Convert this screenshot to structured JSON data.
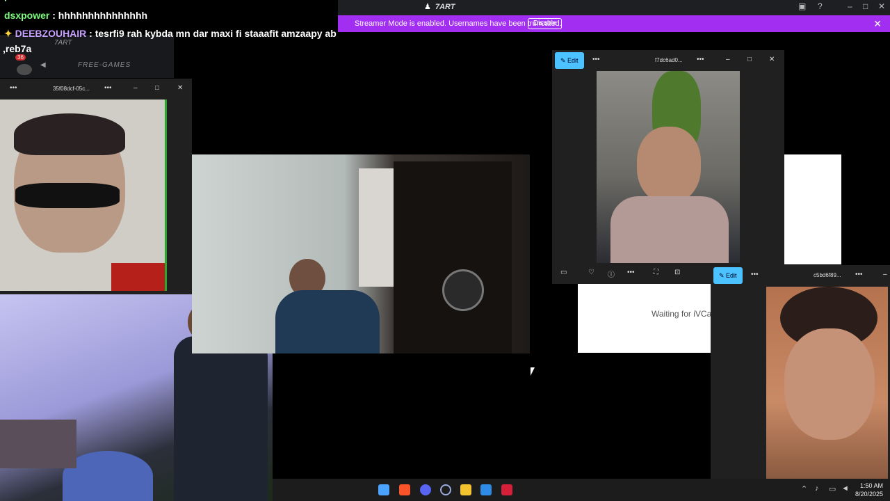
{
  "chat": {
    "line1_user": "dsxpower",
    "line1_msg": " : hhhhhhhhhhhhhhh",
    "line2_user": "DEEBZOUHAIR",
    "line2_msg": " : tesrfi9 rah kybda mn dar maxi fi staaafit amzaapy ab",
    "line3": ",reb7a",
    "badge": "36",
    "server_name": "7ART",
    "channel": "FREE-GAMES"
  },
  "discord": {
    "title": "7ART",
    "streamer_text": "Streamer Mode is enabled. Usernames have been truncated.",
    "disable_label": "Disable"
  },
  "windows": {
    "left": {
      "title": "35f08dcf-05c..."
    },
    "right_top": {
      "title": "f7dc6ad0...",
      "edit_label": "Edit"
    },
    "right_bottom": {
      "title": "c5bd6f89...",
      "edit_label": "Edit"
    }
  },
  "waiting_text": "Waiting for iVCa",
  "clock": {
    "time": "1:50 AM",
    "date": "8/20/2025"
  }
}
